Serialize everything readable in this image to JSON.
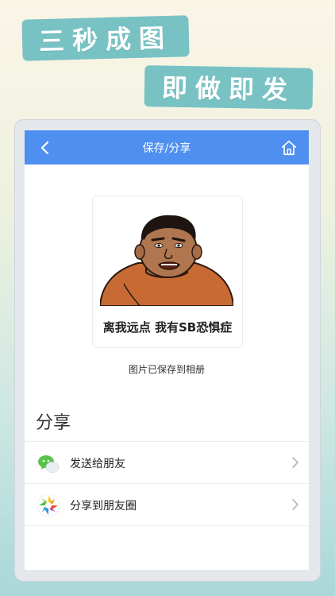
{
  "banners": {
    "line1": "三秒成图",
    "line2": "即做即发"
  },
  "nav": {
    "title": "保存/分享",
    "back_icon": "chevron-left-icon",
    "home_icon": "home-icon"
  },
  "meme": {
    "caption": "离我远点 我有SB恐惧症"
  },
  "status": {
    "saved_message": "图片已保存到相册"
  },
  "share": {
    "title": "分享",
    "items": [
      {
        "label": "发送给朋友",
        "icon": "wechat-icon"
      },
      {
        "label": "分享到朋友圈",
        "icon": "moments-icon"
      }
    ]
  },
  "colors": {
    "nav_bar": "#4f8fef",
    "banner": "#78c2c4"
  }
}
